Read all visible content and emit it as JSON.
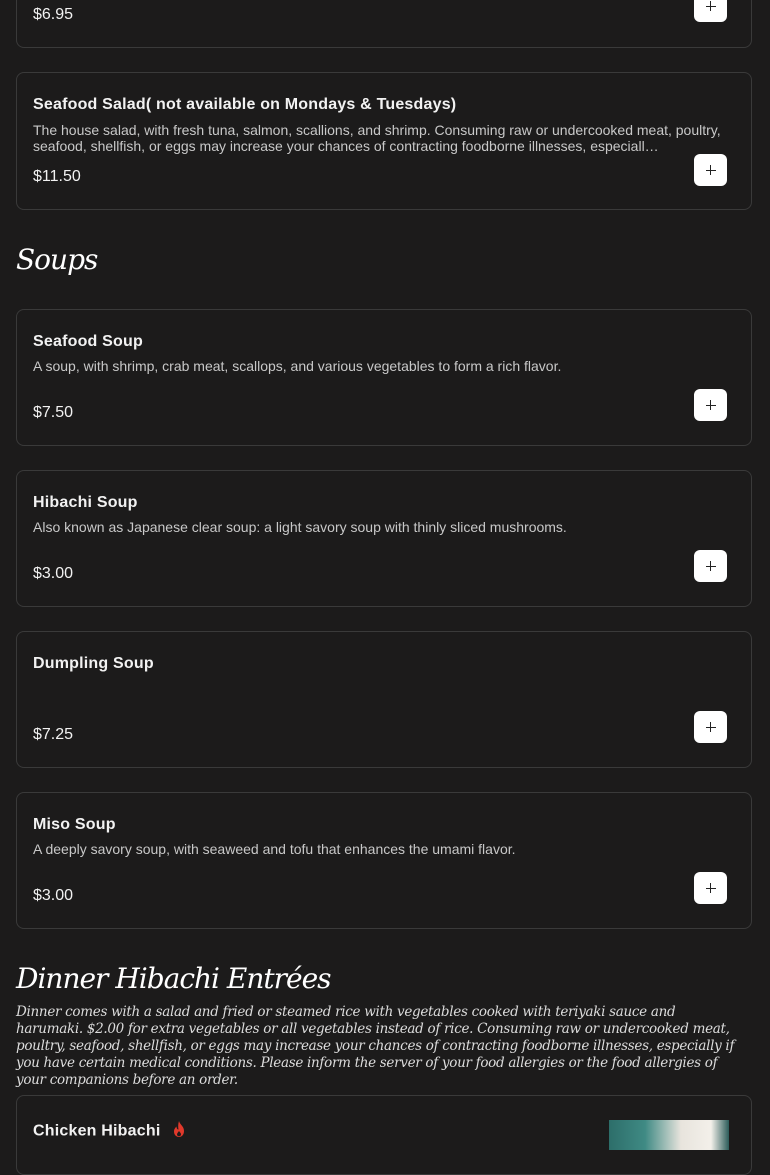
{
  "items": [
    {
      "name": "",
      "desc": "",
      "price": "$6.95"
    },
    {
      "name": "Seafood Salad( not available on Mondays & Tuesdays)",
      "desc": "The house salad, with fresh tuna, salmon, scallions, and shrimp. Consuming raw or undercooked meat, poultry, seafood, shellfish, or eggs may increase your chances of contracting foodborne illnesses, especiall…",
      "price": "$11.50"
    },
    {
      "name": "Seafood Soup",
      "desc": "A soup, with shrimp, crab meat, scallops, and various vegetables to form a rich flavor.",
      "price": "$7.50"
    },
    {
      "name": "Hibachi Soup",
      "desc": "Also known as Japanese clear soup: a light savory soup with thinly sliced mushrooms.",
      "price": "$3.00"
    },
    {
      "name": "Dumpling Soup",
      "desc": "",
      "price": "$7.25"
    },
    {
      "name": "Miso Soup",
      "desc": "A deeply savory soup, with seaweed and tofu that enhances the umami flavor.",
      "price": "$3.00"
    },
    {
      "name": "Chicken Hibachi",
      "desc": "",
      "price": ""
    }
  ],
  "sections": {
    "soups": {
      "title": "Soups"
    },
    "dinner": {
      "title": "Dinner Hibachi Entrées",
      "desc": "Dinner comes with a salad and fried or steamed rice with vegetables cooked with teriyaki sauce and harumaki. $2.00 for extra vegetables or all vegetables instead of rice. Consuming raw or undercooked meat, poultry, seafood, shellfish, or eggs may increase your chances of contracting foodborne illnesses, especially if you have certain medical conditions. Please inform the server of your food allergies or the food allergies of your companions before an order."
    }
  },
  "icons": {
    "add": "plus-icon",
    "spicy": "flame-icon"
  },
  "colors": {
    "background": "#1c1b1b",
    "border": "#3a3a3a",
    "button": "#ffffff",
    "spicy": "#e0392b"
  }
}
